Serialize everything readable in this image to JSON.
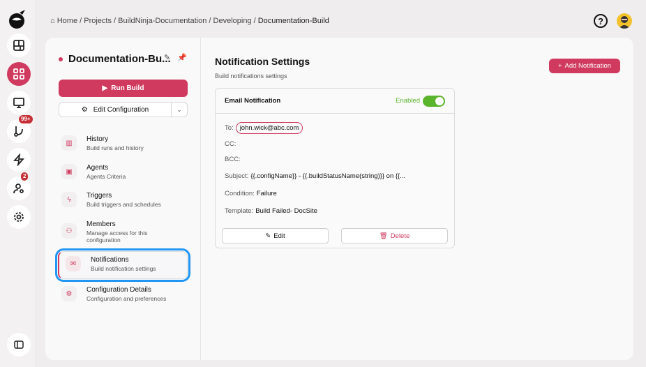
{
  "breadcrumb": [
    "Home",
    "Projects",
    "BuildNinja-Documentation",
    "Developing",
    "Documentation-Build"
  ],
  "rail": {
    "items": [
      {
        "icon": "layout-icon"
      },
      {
        "icon": "grid-icon",
        "active": true
      },
      {
        "icon": "monitor-icon"
      },
      {
        "icon": "git-branch-icon",
        "badge": "99+"
      },
      {
        "icon": "lightning-icon"
      },
      {
        "icon": "user-settings-icon",
        "badge": "2"
      },
      {
        "icon": "gear-icon"
      }
    ]
  },
  "header": {
    "help": "?"
  },
  "sidebar": {
    "title": "Documentation-Bu...",
    "run_label": "Run Build",
    "edit_label": "Edit Configuration",
    "items": [
      {
        "title": "History",
        "subtitle": "Build runs and history",
        "icon": "chart-icon"
      },
      {
        "title": "Agents",
        "subtitle": "Agents Criteria",
        "icon": "agent-icon"
      },
      {
        "title": "Triggers",
        "subtitle": "Build triggers and schedules",
        "icon": "lightning-icon"
      },
      {
        "title": "Members",
        "subtitle": "Manage access for this configuration",
        "icon": "users-icon"
      },
      {
        "title": "Notifications",
        "subtitle": "Build notification settings",
        "icon": "mail-icon",
        "selected": true
      },
      {
        "title": "Configuration Details",
        "subtitle": "Configuration and preferences",
        "icon": "gear-icon"
      }
    ]
  },
  "main": {
    "title": "Notification Settings",
    "subtitle": "Build notifications settings",
    "add_label": "Add Notification",
    "card": {
      "title": "Email Notification",
      "status": "Enabled",
      "enabled": true,
      "to_label": "To:",
      "to": "john.wick@abc.com",
      "cc_label": "CC:",
      "bcc_label": "BCC:",
      "subject_label": "Subject:",
      "subject": "{{.configName}} - {{.buildStatusName(string)}} on {{...",
      "condition_label": "Condition:",
      "condition": "Failure",
      "template_label": "Template:",
      "template": "Build Failed- DocSite",
      "edit_label": "Edit",
      "delete_label": "Delete"
    }
  },
  "colors": {
    "accent": "#cf3a5e",
    "enabled": "#5ab42c",
    "selection": "#2196f3"
  }
}
